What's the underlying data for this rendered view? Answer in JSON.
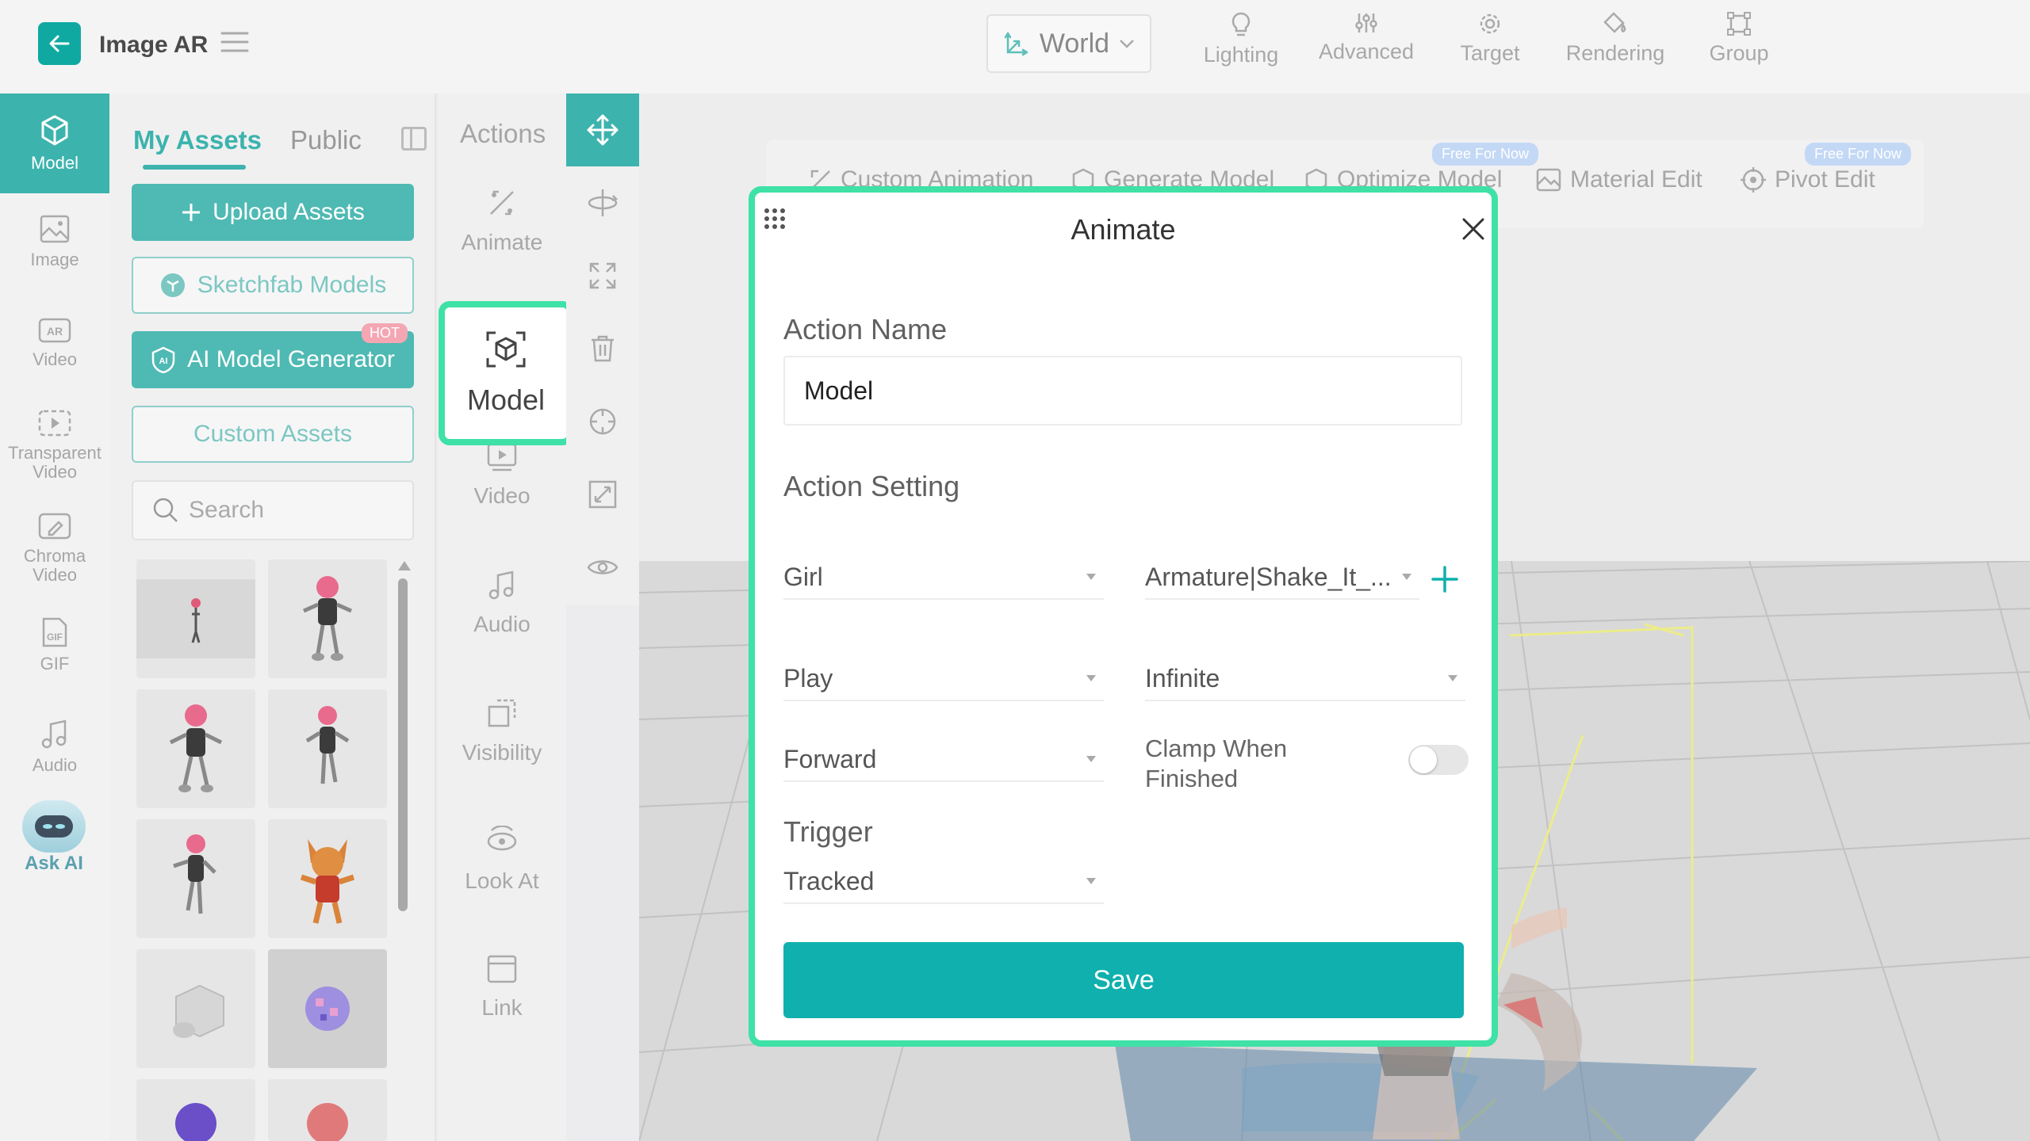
{
  "header": {
    "app_title": "Image AR",
    "world_label": "World",
    "tools": [
      {
        "label": "Lighting",
        "icon": "bulb-icon"
      },
      {
        "label": "Advanced",
        "icon": "sliders-icon"
      },
      {
        "label": "Target",
        "icon": "target-gear-icon"
      },
      {
        "label": "Rendering",
        "icon": "paint-bucket-icon"
      },
      {
        "label": "Group",
        "icon": "group-icon"
      }
    ]
  },
  "leftnav": {
    "items": [
      {
        "label": "Model",
        "icon": "cube-icon"
      },
      {
        "label": "Image",
        "icon": "image-icon"
      },
      {
        "label": "Video",
        "icon": "ar-video-icon"
      },
      {
        "label": "Transparent Video",
        "icon": "transparent-video-icon"
      },
      {
        "label": "Chroma Video",
        "icon": "chroma-video-icon"
      },
      {
        "label": "GIF",
        "icon": "gif-icon"
      },
      {
        "label": "Audio",
        "icon": "music-icon"
      }
    ],
    "ask_ai_label": "Ask AI"
  },
  "assets": {
    "tab_my_assets": "My Assets",
    "tab_public": "Public",
    "upload_label": "Upload Assets",
    "sketchfab_label": "Sketchfab Models",
    "ai_generator_label": "AI Model Generator",
    "hot_badge": "HOT",
    "custom_label": "Custom Assets",
    "search_placeholder": "Search"
  },
  "actions": {
    "title": "Actions",
    "items": [
      {
        "label": "Animate",
        "icon": "animate-icon"
      },
      {
        "label": "Model",
        "icon": "model-box-icon"
      },
      {
        "label": "Video",
        "icon": "video-play-icon"
      },
      {
        "label": "Audio",
        "icon": "music-icon"
      },
      {
        "label": "Visibility",
        "icon": "visibility-icon"
      },
      {
        "label": "Look At",
        "icon": "look-at-icon"
      },
      {
        "label": "Link",
        "icon": "link-window-icon"
      }
    ]
  },
  "subtoolbar": {
    "items": [
      {
        "label": "Custom Animation"
      },
      {
        "label": "Generate Model"
      },
      {
        "label": "Optimize Model"
      },
      {
        "label": "Material Edit"
      },
      {
        "label": "Pivot Edit"
      }
    ],
    "free_badge": "Free For Now"
  },
  "modal": {
    "title": "Animate",
    "action_name_label": "Action Name",
    "action_name_value": "Model",
    "action_setting_label": "Action Setting",
    "target_select": "Girl",
    "clip_select": "Armature|Shake_It_...",
    "play_select": "Play",
    "loop_select": "Infinite",
    "direction_select": "Forward",
    "clamp_label": "Clamp When Finished",
    "clamp_enabled": false,
    "trigger_label": "Trigger",
    "trigger_select": "Tracked",
    "save_label": "Save"
  },
  "colors": {
    "accent": "#0fb0ad",
    "highlight": "#3ee1a6"
  }
}
